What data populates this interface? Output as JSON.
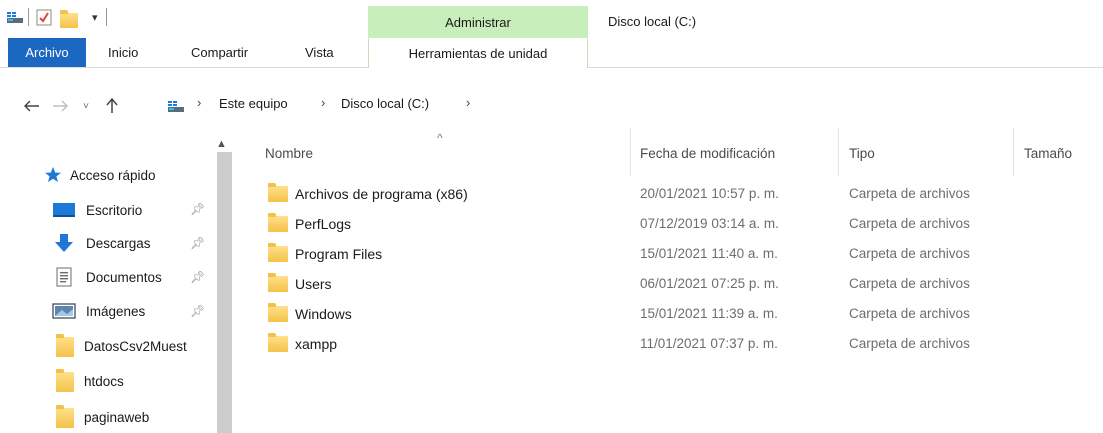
{
  "window": {
    "context_tab": "Administrar",
    "title": "Disco local (C:)"
  },
  "ribbon": {
    "tabs": [
      "Archivo",
      "Inicio",
      "Compartir",
      "Vista"
    ],
    "tools_tab": "Herramientas de unidad"
  },
  "address": {
    "crumbs": [
      "Este equipo",
      "Disco local (C:)"
    ]
  },
  "nav_pane": {
    "quick_access": "Acceso rápido",
    "items": [
      {
        "label": "Escritorio",
        "icon": "desktop-icon",
        "pinned": true
      },
      {
        "label": "Descargas",
        "icon": "download-arrow-icon",
        "pinned": true
      },
      {
        "label": "Documentos",
        "icon": "document-icon",
        "pinned": true
      },
      {
        "label": "Imágenes",
        "icon": "images-icon",
        "pinned": true
      },
      {
        "label": "DatosCsv2Muest",
        "icon": "folder-icon",
        "pinned": false
      },
      {
        "label": "htdocs",
        "icon": "folder-icon",
        "pinned": false
      },
      {
        "label": "paginaweb",
        "icon": "folder-icon",
        "pinned": false
      }
    ]
  },
  "list": {
    "columns": [
      "Nombre",
      "Fecha de modificación",
      "Tipo",
      "Tamaño"
    ],
    "rows": [
      {
        "name": "Archivos de programa (x86)",
        "date": "20/01/2021 10:57 p. m.",
        "type": "Carpeta de archivos"
      },
      {
        "name": "PerfLogs",
        "date": "07/12/2019 03:14 a. m.",
        "type": "Carpeta de archivos"
      },
      {
        "name": "Program Files",
        "date": "15/01/2021 11:40 a. m.",
        "type": "Carpeta de archivos"
      },
      {
        "name": "Users",
        "date": "06/01/2021 07:25 p. m.",
        "type": "Carpeta de archivos"
      },
      {
        "name": "Windows",
        "date": "15/01/2021 11:39 a. m.",
        "type": "Carpeta de archivos"
      },
      {
        "name": "xampp",
        "date": "11/01/2021 07:37 p. m.",
        "type": "Carpeta de archivos"
      }
    ]
  },
  "colors": {
    "file_tab": "#1b67c2",
    "context_tab": "#c8eebc",
    "folder": "#f4c24a",
    "accent_blue": "#1e78d7"
  }
}
